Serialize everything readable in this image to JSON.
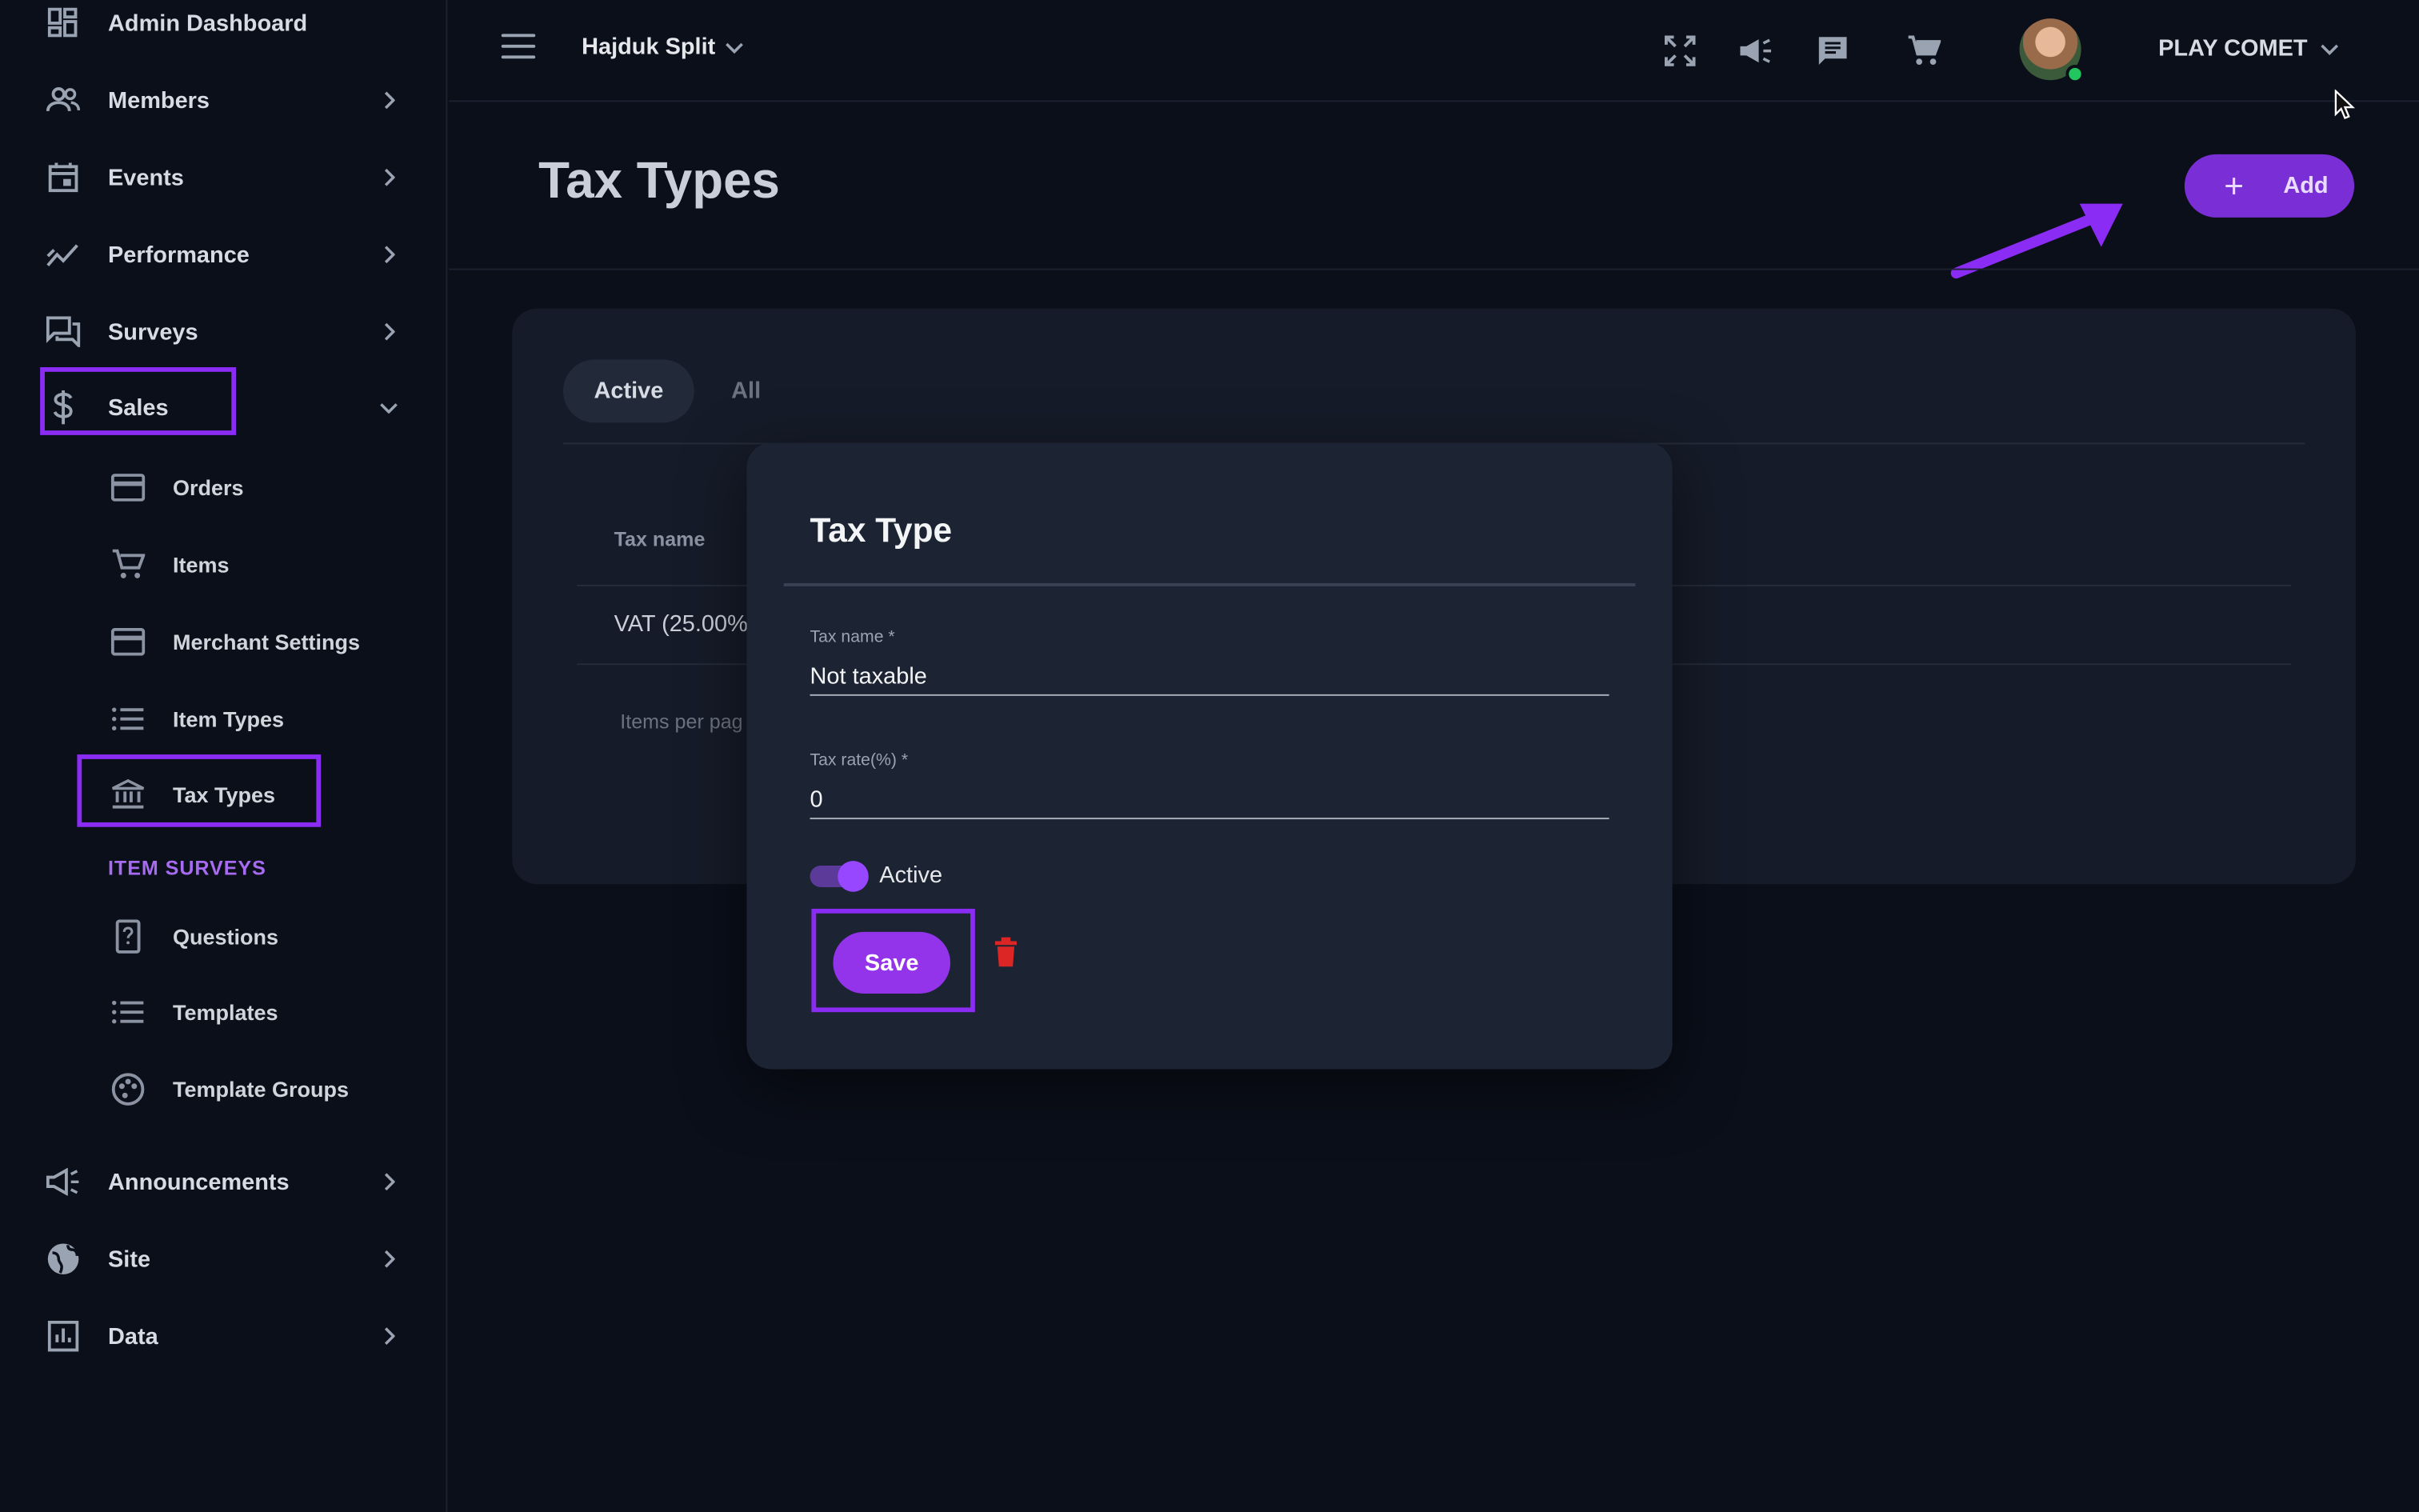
{
  "sidebar": {
    "items": [
      {
        "label": "Admin Dashboard",
        "icon": "dashboard-icon"
      },
      {
        "label": "Members",
        "icon": "people-icon"
      },
      {
        "label": "Events",
        "icon": "calendar-icon"
      },
      {
        "label": "Performance",
        "icon": "trending-icon"
      },
      {
        "label": "Surveys",
        "icon": "forum-icon"
      },
      {
        "label": "Sales",
        "icon": "dollar-icon"
      },
      {
        "label": "Announcements",
        "icon": "megaphone-icon"
      },
      {
        "label": "Site",
        "icon": "globe-icon"
      },
      {
        "label": "Data",
        "icon": "chart-icon"
      }
    ],
    "sales_sub": [
      {
        "label": "Orders",
        "icon": "card-icon"
      },
      {
        "label": "Items",
        "icon": "cart-icon"
      },
      {
        "label": "Merchant Settings",
        "icon": "card-icon"
      },
      {
        "label": "Item Types",
        "icon": "list-icon"
      },
      {
        "label": "Tax Types",
        "icon": "bank-icon"
      }
    ],
    "item_surveys_label": "ITEM SURVEYS",
    "survey_sub": [
      {
        "label": "Questions",
        "icon": "help-doc-icon"
      },
      {
        "label": "Templates",
        "icon": "list-icon"
      },
      {
        "label": "Template Groups",
        "icon": "palette-icon"
      }
    ]
  },
  "header": {
    "org": "Hajduk Split",
    "account": "PLAY COMET"
  },
  "page": {
    "title": "Tax Types",
    "add_label": "Add",
    "tabs": {
      "active": "Active",
      "all": "All"
    },
    "table": {
      "header_tax_name": "Tax name",
      "row_value": "VAT (25.00%",
      "items_per_page": "Items per pag"
    }
  },
  "dialog": {
    "title": "Tax Type",
    "tax_name_label": "Tax name *",
    "tax_name_value": "Not taxable",
    "tax_rate_label": "Tax rate(%) *",
    "tax_rate_value": "0",
    "active_label": "Active",
    "active": true,
    "save_label": "Save"
  },
  "colors": {
    "accent": "#9333ea",
    "highlight": "#8b2cf5",
    "danger": "#dc2626",
    "background": "#0b0f1a"
  }
}
